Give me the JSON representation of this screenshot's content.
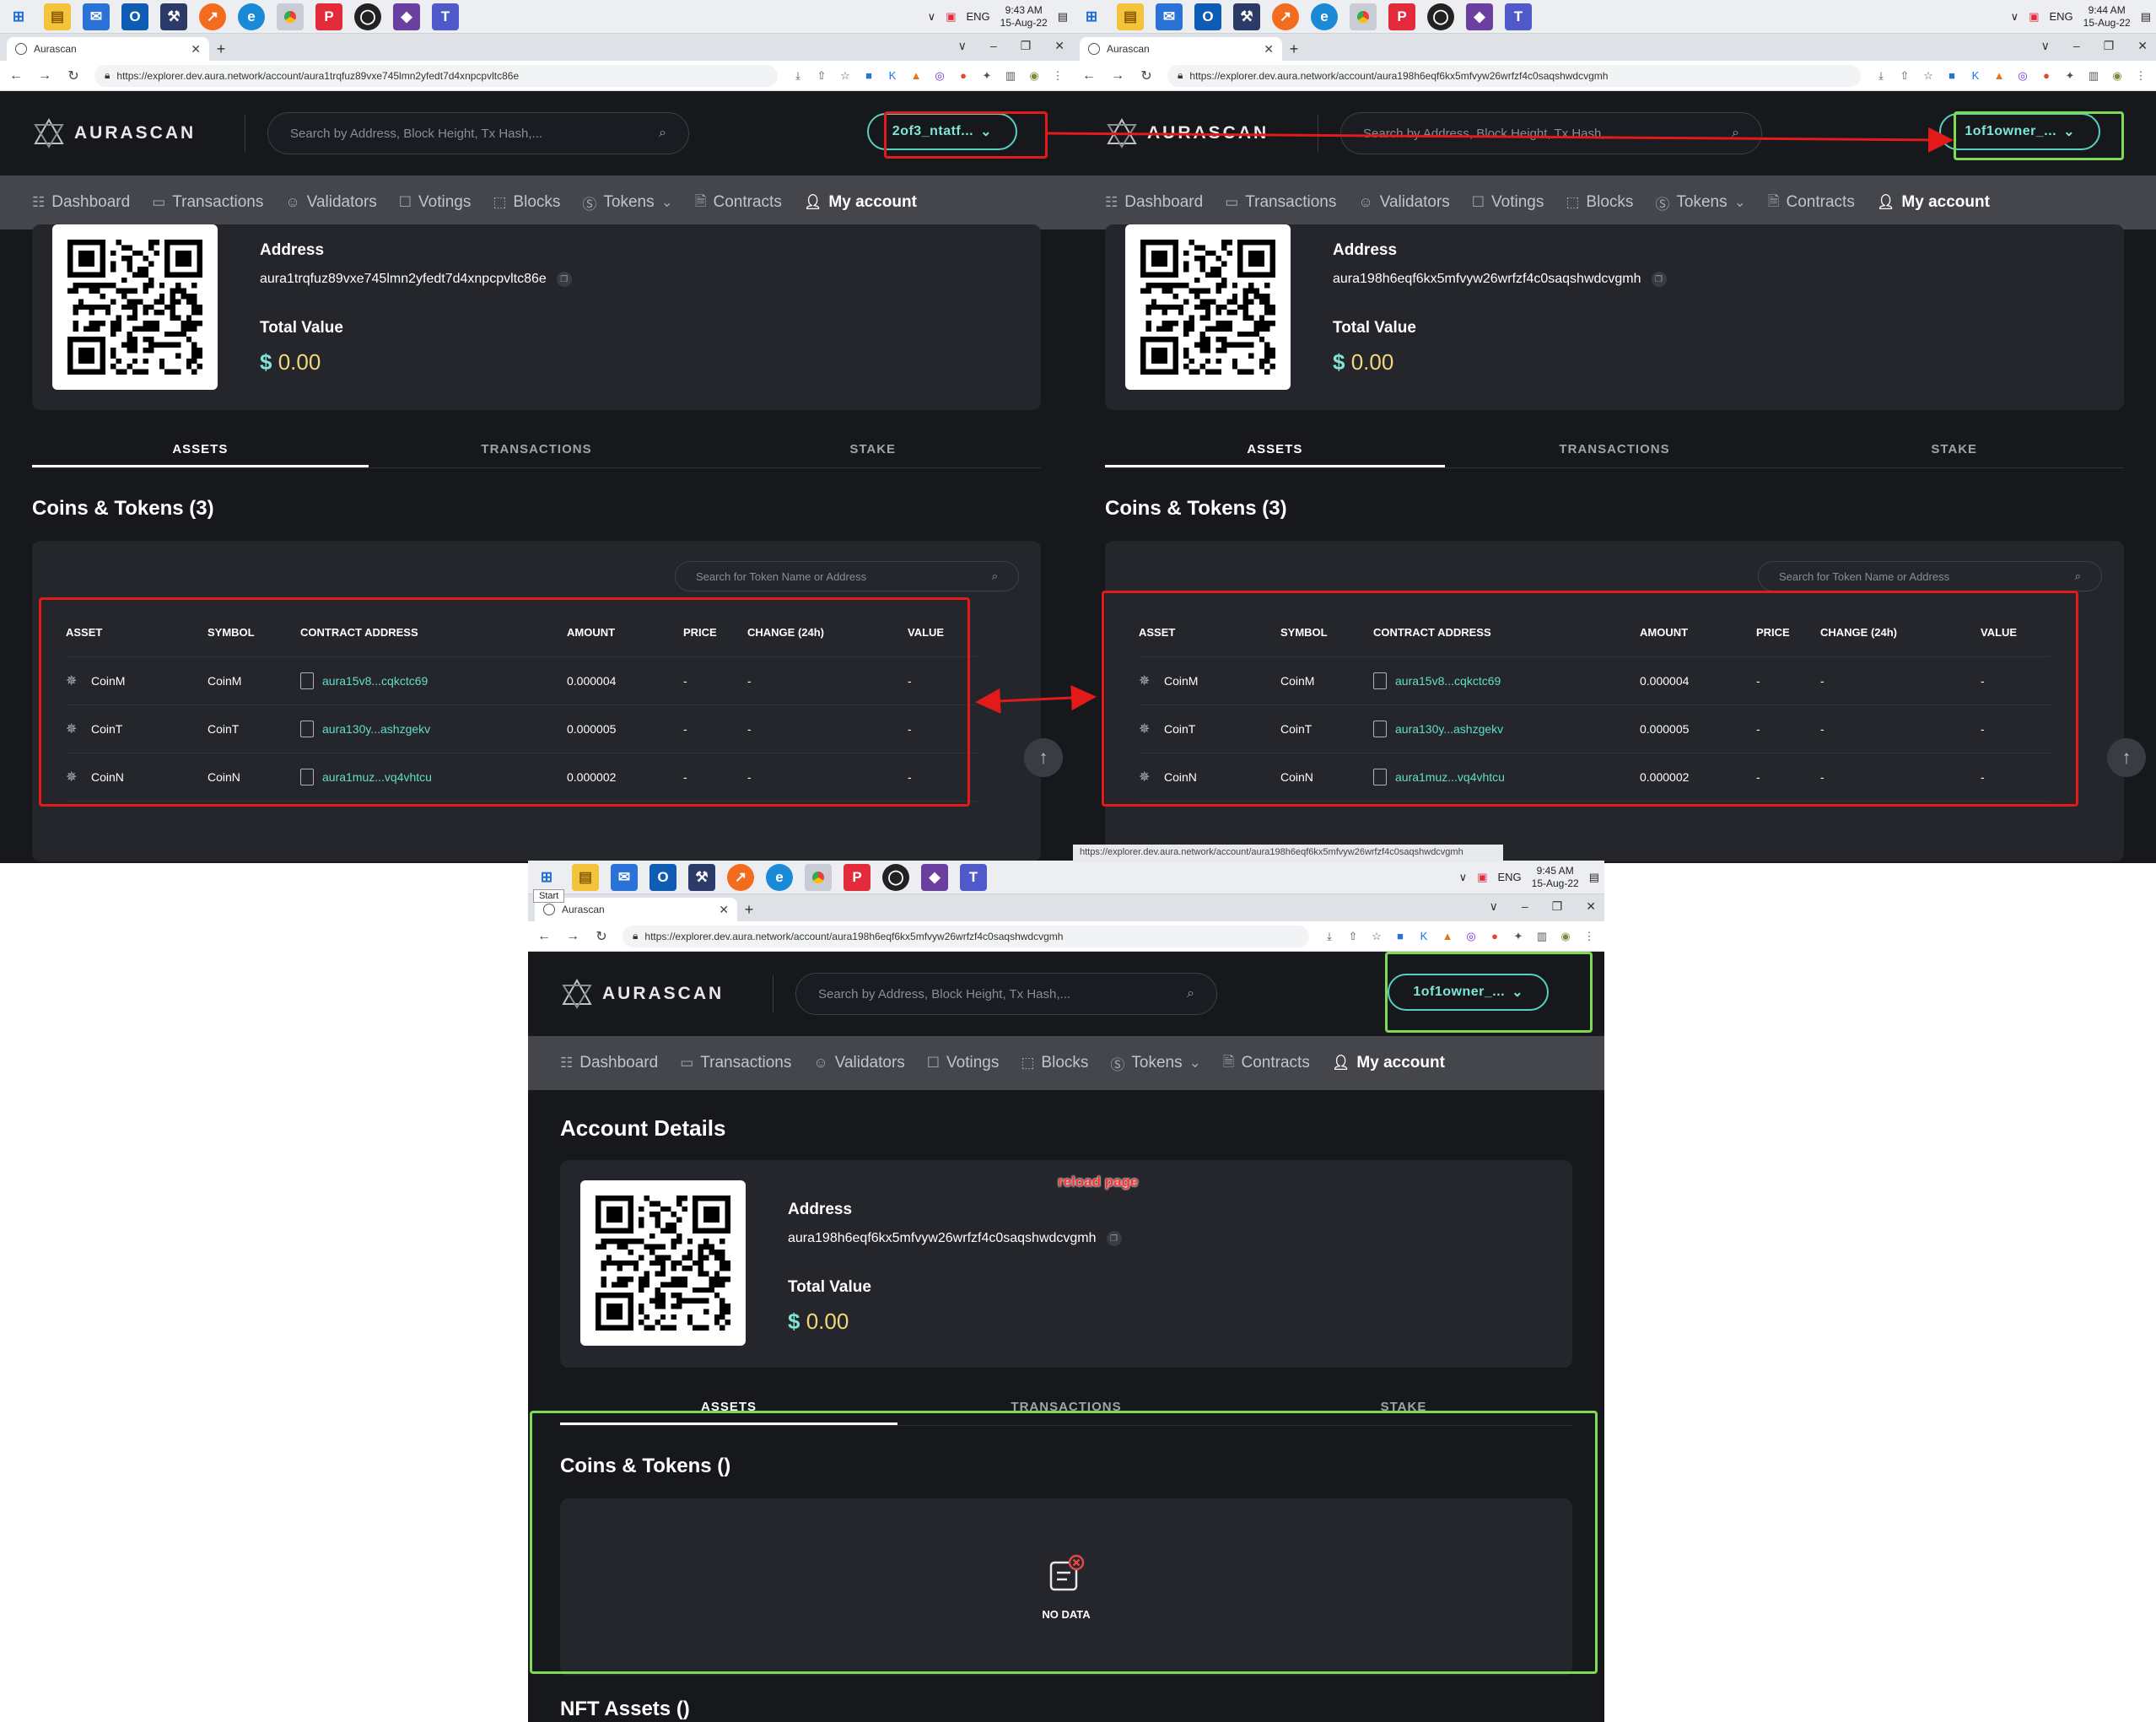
{
  "win_a": {
    "clock_time": "9:43 AM",
    "clock_date": "15-Aug-22",
    "lang": "ENG",
    "tab_title": "Aurascan",
    "url": "https://explorer.dev.aura.network/account/aura1trqfuz89vxe745lmn2yfedt7d4xnpcpvltc86e",
    "wallet": "2of3_ntatf...",
    "address": "aura1trqfuz89vxe745lmn2yfedt7d4xnpcpvltc86e"
  },
  "win_b": {
    "clock_time": "9:44 AM",
    "clock_date": "15-Aug-22",
    "lang": "ENG",
    "tab_title": "Aurascan",
    "url": "https://explorer.dev.aura.network/account/aura198h6eqf6kx5mfvyw26wrfzf4c0saqshwdcvgmh",
    "wallet": "1of1owner_...",
    "address": "aura198h6eqf6kx5mfvyw26wrfzf4c0saqshwdcvgmh"
  },
  "win_c": {
    "clock_time": "9:45 AM",
    "clock_date": "15-Aug-22",
    "lang": "ENG",
    "tab_title": "Aurascan",
    "start_tooltip": "Start",
    "url": "https://explorer.dev.aura.network/account/aura198h6eqf6kx5mfvyw26wrfzf4c0saqshwdcvgmh",
    "wallet": "1of1owner_...",
    "address": "aura198h6eqf6kx5mfvyw26wrfzf4c0saqshwdcvgmh",
    "page_title": "Account Details",
    "reload_note": "reload page",
    "coins_title": "Coins & Tokens ()",
    "no_data": "NO DATA",
    "nft_title": "NFT Assets ()"
  },
  "site": {
    "logo": "AURASCAN",
    "search_placeholder": "Search by Address, Block Height, Tx Hash,...",
    "menu": [
      "Dashboard",
      "Transactions",
      "Validators",
      "Votings",
      "Blocks",
      "Tokens",
      "Contracts",
      "My account"
    ],
    "address_label": "Address",
    "total_value_label": "Total Value",
    "total_value_currency": "$",
    "total_value": "0.00",
    "tabs": [
      "ASSETS",
      "TRANSACTIONS",
      "STAKE"
    ],
    "coins_title": "Coins & Tokens (3)",
    "token_search_placeholder": "Search for Token Name or Address"
  },
  "token_table": {
    "headers": [
      "ASSET",
      "SYMBOL",
      "CONTRACT ADDRESS",
      "AMOUNT",
      "PRICE",
      "CHANGE (24h)",
      "VALUE"
    ],
    "rows": [
      {
        "asset": "CoinM",
        "symbol": "CoinM",
        "contract": "aura15v8...cqkctc69",
        "amount": "0.000004",
        "price": "-",
        "change": "-",
        "value": "-"
      },
      {
        "asset": "CoinT",
        "symbol": "CoinT",
        "contract": "aura130y...ashzgekv",
        "amount": "0.000005",
        "price": "-",
        "change": "-",
        "value": "-"
      },
      {
        "asset": "CoinN",
        "symbol": "CoinN",
        "contract": "aura1muz...vq4vhtcu",
        "amount": "0.000002",
        "price": "-",
        "change": "-",
        "value": "-"
      }
    ]
  },
  "colors": {
    "accent": "#62ddc9",
    "annotation_red": "#e21a1a",
    "annotation_green": "#7ed957",
    "bg": "#17181c",
    "panel": "#24262c"
  }
}
